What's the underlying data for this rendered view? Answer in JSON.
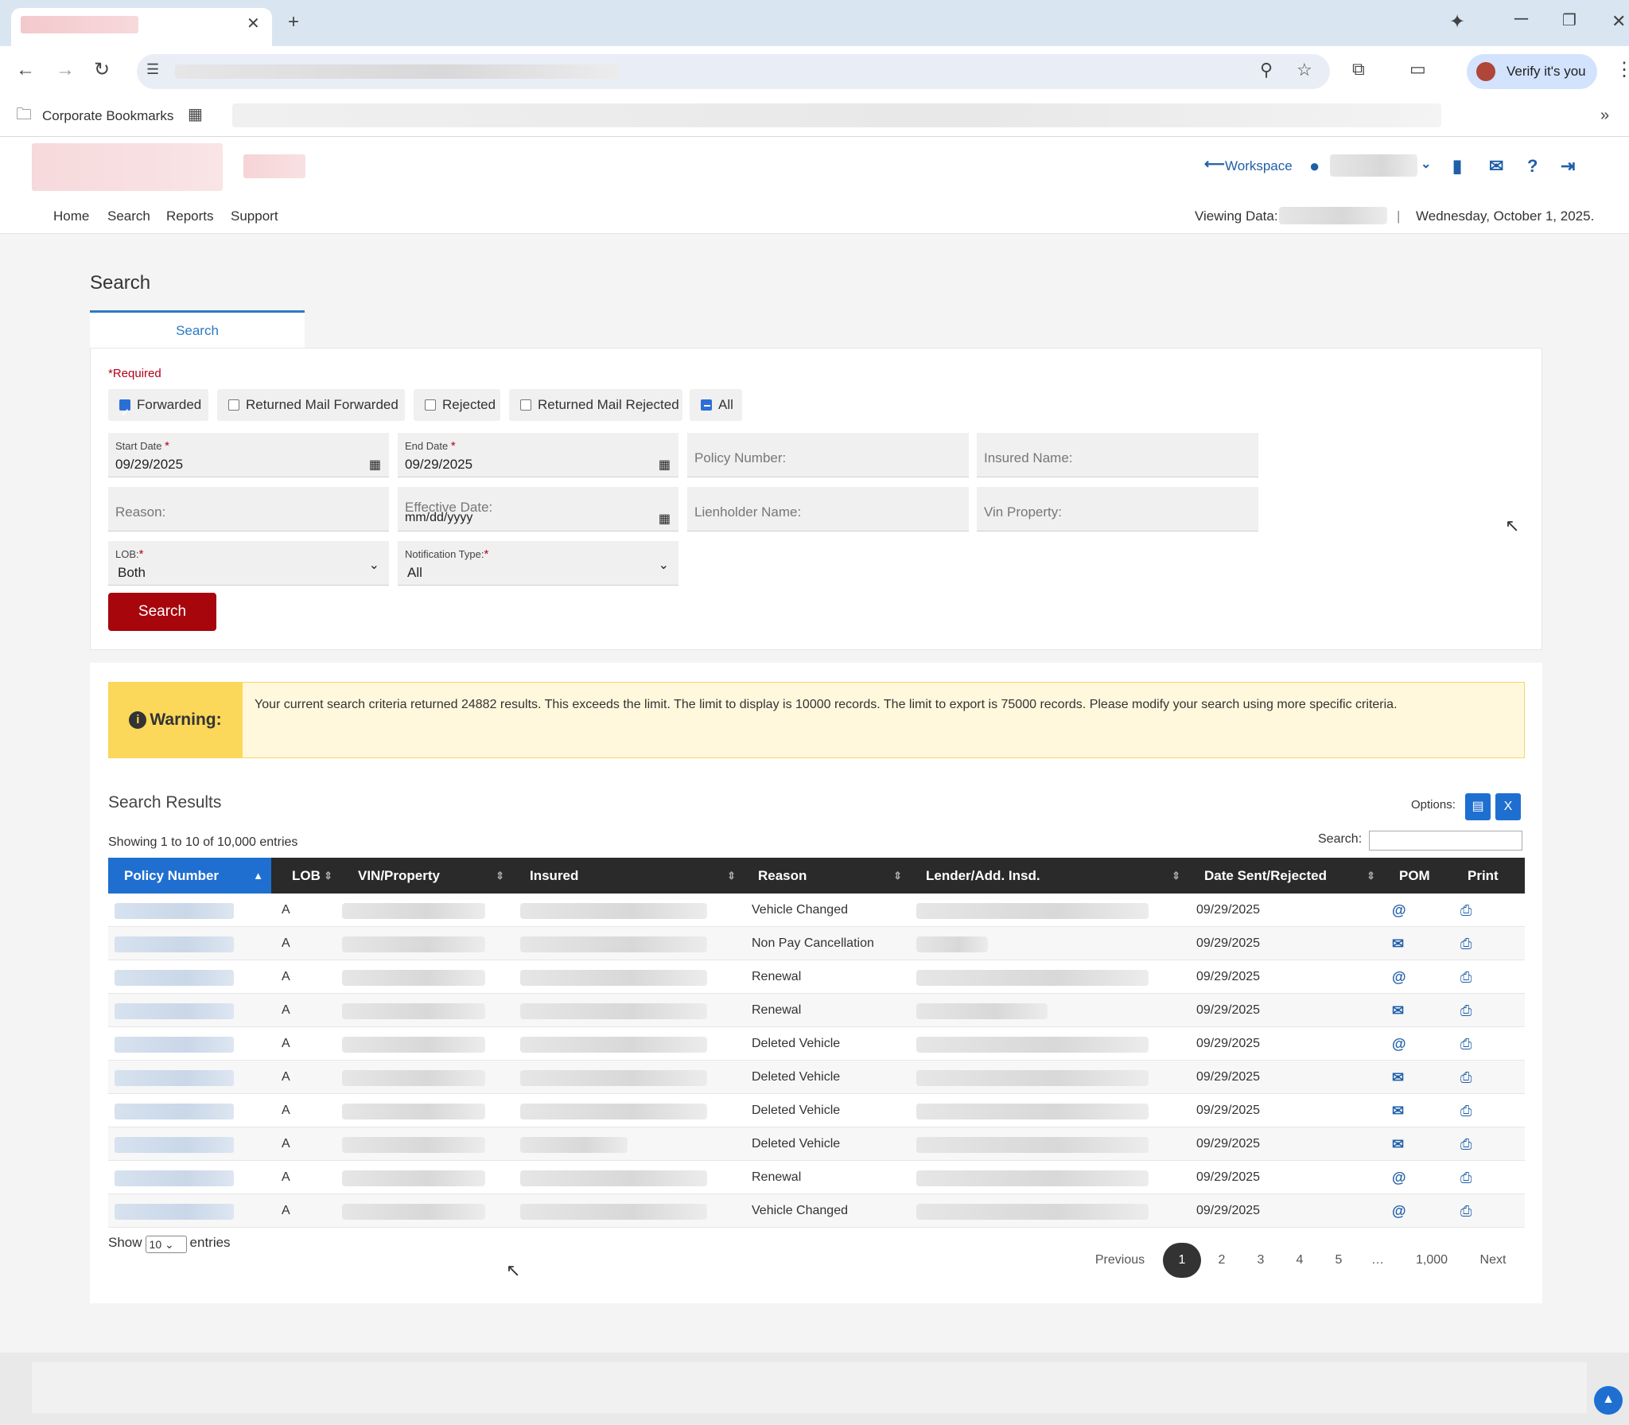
{
  "browser": {
    "verify_label": "Verify it's you",
    "bookmarks_label": "Corporate Bookmarks",
    "more_chevron": "»"
  },
  "header": {
    "workspace_label": "Workspace",
    "nav": [
      "Home",
      "Search",
      "Reports",
      "Support"
    ],
    "viewing_label": "Viewing Data:",
    "date_text": "Wednesday, October 1, 2025."
  },
  "page": {
    "title": "Search",
    "tab_label": "Search"
  },
  "form": {
    "required_text": "*Required",
    "checkboxes": [
      {
        "label": "Forwarded",
        "state": "checked"
      },
      {
        "label": "Returned Mail Forwarded",
        "state": "unchecked"
      },
      {
        "label": "Rejected",
        "state": "unchecked"
      },
      {
        "label": "Returned Mail Rejected",
        "state": "unchecked"
      },
      {
        "label": "All",
        "state": "mixed"
      }
    ],
    "start_date": {
      "label": "Start Date",
      "value": "09/29/2025"
    },
    "end_date": {
      "label": "End Date",
      "value": "09/29/2025"
    },
    "policy_number": {
      "placeholder": "Policy Number:"
    },
    "insured_name": {
      "placeholder": "Insured Name:"
    },
    "reason": {
      "placeholder": "Reason:"
    },
    "effective_date": {
      "label": "Effective Date:",
      "value": "mm/dd/yyyy"
    },
    "lienholder_name": {
      "placeholder": "Lienholder Name:"
    },
    "vin_property": {
      "placeholder": "Vin Property:"
    },
    "lob": {
      "label": "LOB:",
      "value": "Both"
    },
    "notification_type": {
      "label": "Notification Type:",
      "value": "All"
    },
    "search_button": "Search",
    "required_star": "*"
  },
  "warning": {
    "label": "Warning:",
    "text": "Your current search criteria returned 24882 results. This exceeds the limit. The limit to display is 10000 records. The limit to export is 75000 records. Please modify your search using more specific criteria."
  },
  "results": {
    "title": "Search Results",
    "options_label": "Options:",
    "showing_text": "Showing 1 to 10 of 10,000 entries",
    "search_label": "Search:",
    "columns": [
      "Policy Number",
      "LOB",
      "VIN/Property",
      "Insured",
      "Reason",
      "Lender/Add. Insd.",
      "Date Sent/Rejected",
      "POM",
      "Print"
    ],
    "rows": [
      {
        "lob": "A",
        "reason": "Vehicle Changed",
        "date": "09/29/2025",
        "pom": "email"
      },
      {
        "lob": "A",
        "reason": "Non Pay Cancellation",
        "date": "09/29/2025",
        "pom": "mail"
      },
      {
        "lob": "A",
        "reason": "Renewal",
        "date": "09/29/2025",
        "pom": "email"
      },
      {
        "lob": "A",
        "reason": "Renewal",
        "date": "09/29/2025",
        "pom": "mail"
      },
      {
        "lob": "A",
        "reason": "Deleted Vehicle",
        "date": "09/29/2025",
        "pom": "email"
      },
      {
        "lob": "A",
        "reason": "Deleted Vehicle",
        "date": "09/29/2025",
        "pom": "mail"
      },
      {
        "lob": "A",
        "reason": "Deleted Vehicle",
        "date": "09/29/2025",
        "pom": "mail"
      },
      {
        "lob": "A",
        "reason": "Deleted Vehicle",
        "date": "09/29/2025",
        "pom": "mail"
      },
      {
        "lob": "A",
        "reason": "Renewal",
        "date": "09/29/2025",
        "pom": "email"
      },
      {
        "lob": "A",
        "reason": "Vehicle Changed",
        "date": "09/29/2025",
        "pom": "email"
      }
    ],
    "show_label": "Show",
    "entries_value": "10",
    "entries_label": "entries",
    "pagination": [
      "Previous",
      "1",
      "2",
      "3",
      "4",
      "5",
      "…",
      "1,000",
      "Next"
    ],
    "active_page": "1"
  },
  "colors": {
    "brand_red": "#a6060c",
    "accent_blue": "#1f6fd0",
    "warning_yellow": "#fbd75a"
  }
}
